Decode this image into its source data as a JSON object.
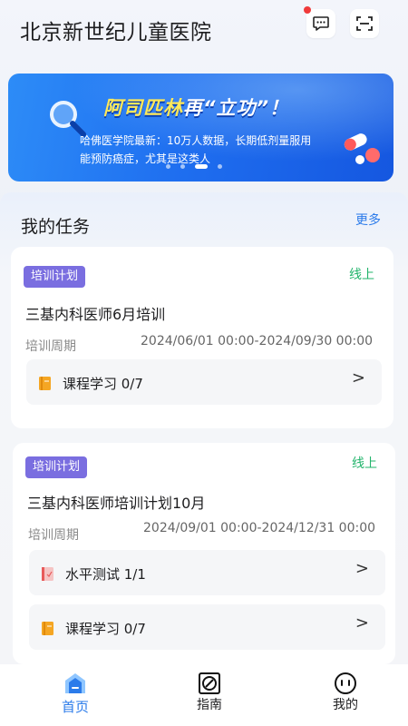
{
  "header": {
    "title": "北京新世纪儿童医院",
    "message_icon": "chat-bubble-icon",
    "scan_icon": "scan-icon",
    "notification_color": "#f03a3a"
  },
  "banner": {
    "headline_a": "阿司匹林",
    "headline_b": "再“立功”！",
    "subtitle_line1": "哈佛医学院最新：10万人数据，长期低剂量服用",
    "subtitle_line2": "能预防癌症，尤其是这类人",
    "active_slide": 3,
    "slide_count": 4
  },
  "tasks": {
    "title": "我的任务",
    "more_label": "更多",
    "cards": [
      {
        "tag": "培训计划",
        "mode": "线上",
        "title": "三基内科医师6月培训",
        "period_label": "培训周期",
        "period_value": "2024/06/01 00:00-2024/09/30 00:00",
        "items": [
          {
            "label": "课程学习 0/7",
            "icon": "book-icon"
          }
        ]
      },
      {
        "tag": "培训计划",
        "mode": "线上",
        "title": "三基内科医师培训计划10月",
        "period_label": "培训周期",
        "period_value": "2024/09/01 00:00-2024/12/31 00:00",
        "items": [
          {
            "label": "水平测试 1/1",
            "icon": "test-icon"
          },
          {
            "label": "课程学习 0/7",
            "icon": "book-icon"
          }
        ]
      }
    ]
  },
  "tabbar": {
    "tabs": [
      {
        "label": "首页",
        "icon": "home-icon",
        "active": true
      },
      {
        "label": "指南",
        "icon": "guide-icon",
        "active": false
      },
      {
        "label": "我的",
        "icon": "profile-icon",
        "active": false
      }
    ]
  },
  "colors": {
    "accent": "#2b7bea",
    "tag": "#7a6ee0",
    "online": "#22b46b",
    "banner": "#1f6ff0"
  }
}
